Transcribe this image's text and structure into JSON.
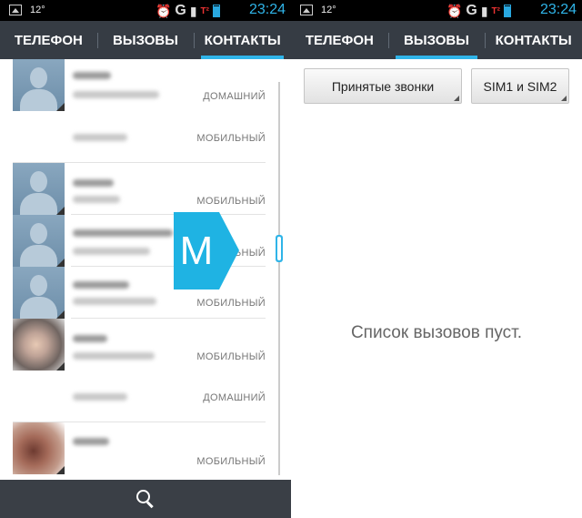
{
  "status_bar": {
    "temperature": "12°",
    "time": "23:24",
    "network": "G",
    "sim": "T²"
  },
  "left": {
    "tabs": [
      {
        "label": "ТЕЛЕФОН",
        "active": false
      },
      {
        "label": "ВЫЗОВЫ",
        "active": false
      },
      {
        "label": "КОНТАКТЫ",
        "active": true
      }
    ],
    "contacts": [
      {
        "avatar": "default",
        "numbers": [
          "ДОМАШНИЙ",
          "МОБИЛЬНЫЙ"
        ]
      },
      {
        "avatar": "default",
        "numbers": [
          "МОБИЛЬНЫЙ"
        ]
      },
      {
        "avatar": "default",
        "numbers": [
          "МОБИЛЬНЫЙ"
        ]
      },
      {
        "avatar": "default",
        "numbers": [
          "МОБИЛЬНЫЙ"
        ]
      },
      {
        "avatar": "photo",
        "numbers": [
          "МОБИЛЬНЫЙ",
          "ДОМАШНИЙ"
        ]
      },
      {
        "avatar": "photo",
        "numbers": [
          "МОБИЛЬНЫЙ"
        ]
      }
    ],
    "overlay_logo": "M",
    "bottom_icon": "search-icon"
  },
  "right": {
    "tabs": [
      {
        "label": "ТЕЛЕФОН",
        "active": false
      },
      {
        "label": "ВЫЗОВЫ",
        "active": true
      },
      {
        "label": "КОНТАКТЫ",
        "active": false
      }
    ],
    "filter_button": "Принятые звонки",
    "sim_button": "SIM1 и SIM2",
    "empty_text": "Список вызовов пуст."
  },
  "colors": {
    "accent": "#2fb4e8",
    "tabbar": "#363c44",
    "logo": "#1fb3e3"
  }
}
